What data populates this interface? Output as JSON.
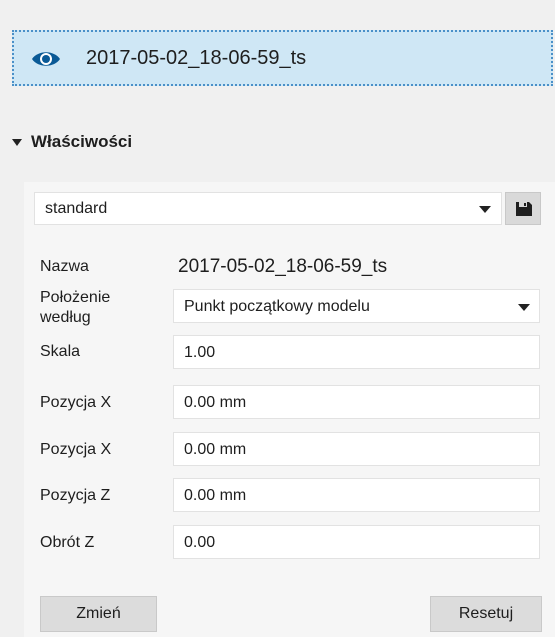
{
  "object": {
    "name": "2017-05-02_18-06-59_ts",
    "visibility_icon": "eye-icon"
  },
  "section": {
    "title": "Właściwości",
    "expanded": true
  },
  "preset": {
    "value": "standard",
    "save_icon": "save-icon"
  },
  "properties": {
    "name_label": "Nazwa",
    "name_value": "2017-05-02_18-06-59_ts",
    "position_by_label_line1": "Położenie",
    "position_by_label_line2": "według",
    "position_by_value": "Punkt początkowy modelu",
    "scale_label": "Skala",
    "scale_value": "1.00",
    "pos_x_label": "Pozycja X",
    "pos_x_value": "0.00 mm",
    "pos_x2_label": "Pozycja X",
    "pos_x2_value": "0.00 mm",
    "pos_z_label": "Pozycja Z",
    "pos_z_value": "0.00 mm",
    "rot_z_label": "Obrót Z",
    "rot_z_value": "0.00"
  },
  "buttons": {
    "change": "Zmień",
    "reset": "Resetuj"
  },
  "colors": {
    "selection_bg": "#cfe7f5",
    "selection_border": "#4a90c8",
    "eye_icon": "#0a5a96"
  }
}
